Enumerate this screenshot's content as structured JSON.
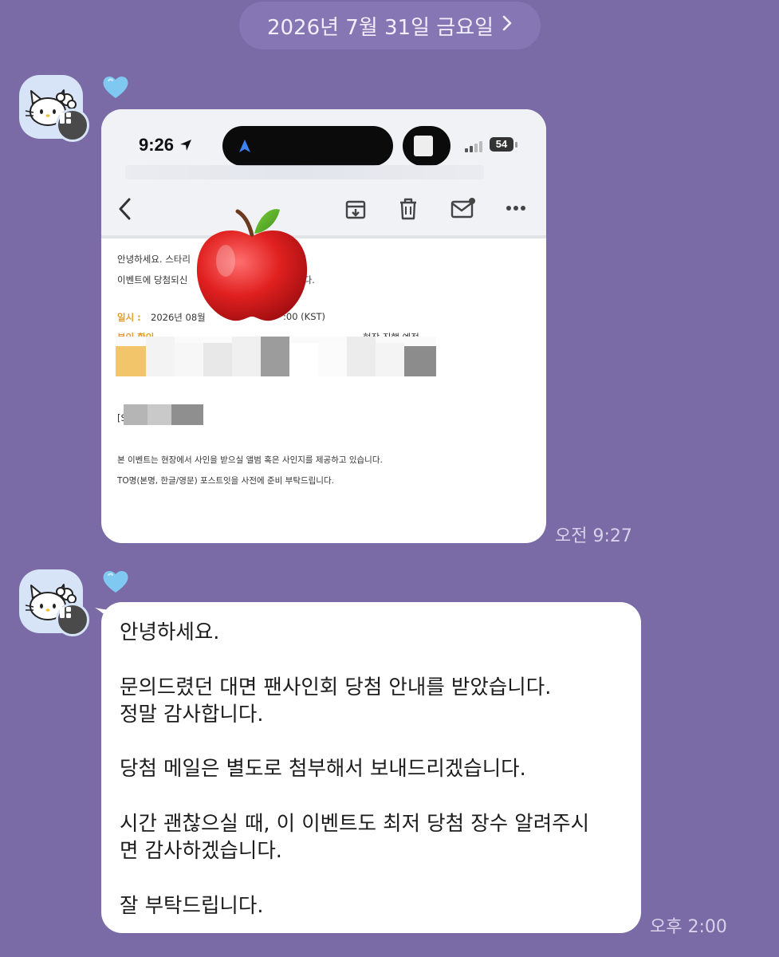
{
  "date_divider": {
    "label": "2026년 7월 31일 금요일",
    "chevron": "chevron-right-icon"
  },
  "messages": [
    {
      "type": "image",
      "sender_reaction": "blue-heart",
      "timestamp": "오전 9:27",
      "screenshot": {
        "status_time": "9:26",
        "battery": "54",
        "mail_lines": {
          "greeting": "안녕하세요. 스타리",
          "line2": "이벤트에 당첨되신",
          "line2_end": "니다.",
          "date_label": "일시 :",
          "date_value": "2026년 08월",
          "date_value_end": ":00 (KST)",
          "id_label": "본인 확인",
          "id_value_end": "현장 진행 예정",
          "s_label": "[S",
          "note1": "본 이벤트는 현장에서 사인을 받으실 앨범 혹은 사인지를 제공하고 있습니다.",
          "note2": "TO명(본명, 한글/영문) 포스트잇을 사전에 준비 부탁드립니다."
        }
      }
    },
    {
      "type": "text",
      "sender_reaction": "blue-heart",
      "timestamp": "오후 2:00",
      "lines": [
        "안녕하세요.",
        "",
        "문의드렸던 대면 팬사인회 당첨 안내를 받았습니다.",
        "정말 감사합니다.",
        "",
        "당첨 메일은 별도로 첨부해서 보내드리겠습니다.",
        "",
        "시간 괜찮으실 때, 이 이벤트도 최저 당첨 장수 알려주시",
        "면 감사하겠습니다.",
        "",
        "잘 부탁드립니다."
      ]
    }
  ],
  "colors": {
    "background": "#7a6aa5",
    "bubble": "#ffffff",
    "timestamp": "#d8d2ea",
    "mail_highlight": "#e39b2b"
  }
}
